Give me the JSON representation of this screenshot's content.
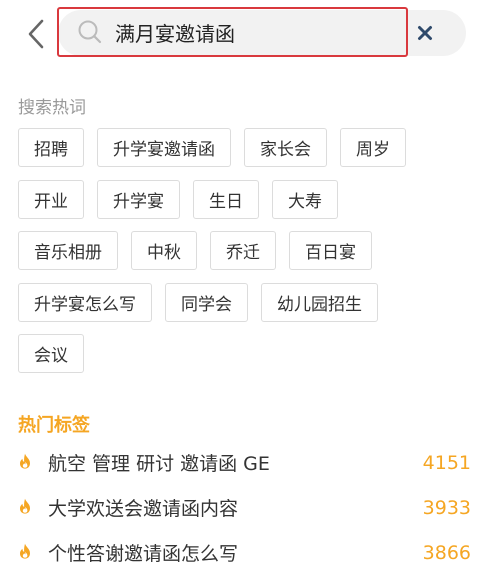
{
  "search": {
    "value": "满月宴邀请函",
    "placeholder": ""
  },
  "hot_searches": {
    "label": "搜索热词",
    "rows": [
      [
        "招聘",
        "升学宴邀请函",
        "家长会",
        "周岁"
      ],
      [
        "开业",
        "升学宴",
        "生日",
        "大寿"
      ],
      [
        "音乐相册",
        "中秋",
        "乔迁",
        "百日宴"
      ],
      [
        "升学宴怎么写",
        "同学会",
        "幼儿园招生"
      ],
      [
        "会议"
      ]
    ]
  },
  "hot_tags": {
    "title": "热门标签",
    "items": [
      {
        "text": "航空 管理 研讨 邀请函 GE",
        "count": "4151"
      },
      {
        "text": "大学欢送会邀请函内容",
        "count": "3933"
      },
      {
        "text": "个性答谢邀请函怎么写",
        "count": "3866"
      }
    ]
  },
  "icons": {
    "back": "chevron-left-icon",
    "search": "search-icon",
    "clear": "close-icon",
    "tag": "flame-icon"
  },
  "colors": {
    "accent": "#f5a623",
    "focus_border": "#d9393e",
    "clear_icon": "#2f4a6b",
    "muted_text": "#999999"
  }
}
